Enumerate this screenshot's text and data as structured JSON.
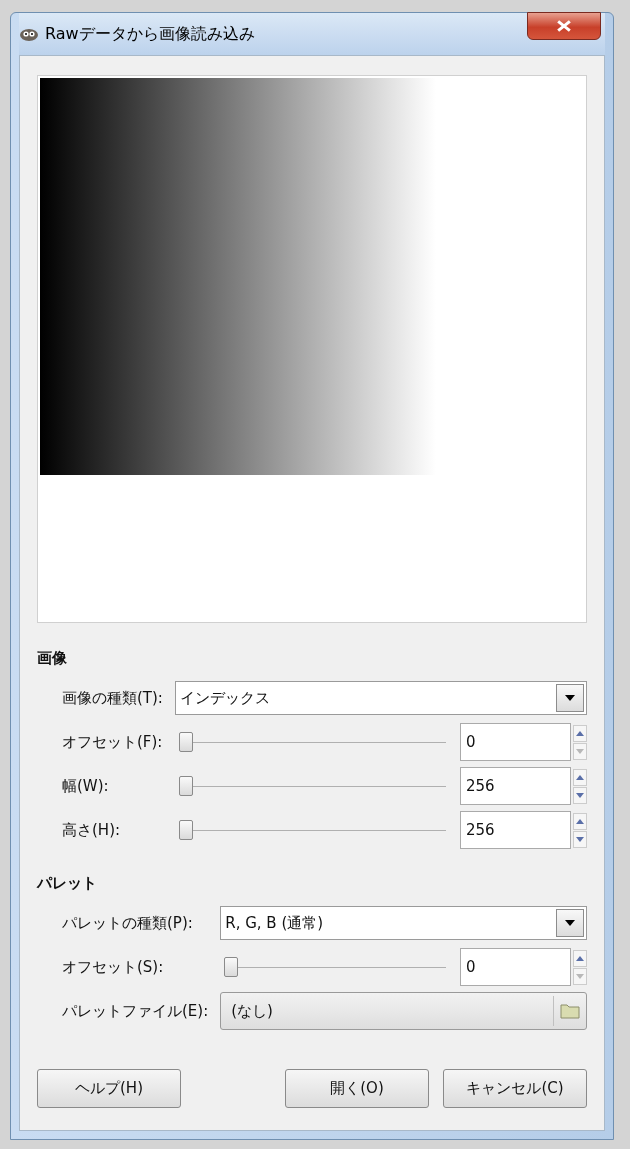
{
  "window": {
    "title": "Rawデータから画像読み込み"
  },
  "preview": {
    "kind": "gradient"
  },
  "sections": [
    {
      "title": "画像",
      "rows": [
        {
          "kind": "combo",
          "label": "画像の種類(T):",
          "value": "インデックス"
        },
        {
          "kind": "slider",
          "label": "オフセット(F):",
          "level": 0,
          "value": "0",
          "down_disabled": true
        },
        {
          "kind": "slider",
          "label": "幅(W):",
          "level": 0,
          "value": "256",
          "down_disabled": false
        },
        {
          "kind": "slider",
          "label": "高さ(H):",
          "level": 0,
          "value": "256",
          "down_disabled": false
        }
      ]
    },
    {
      "title": "パレット",
      "rows": [
        {
          "kind": "combo",
          "label": "パレットの種類(P):",
          "value": "R, G, B (通常)"
        },
        {
          "kind": "slider",
          "label": "オフセット(S):",
          "level": 0,
          "value": "0",
          "down_disabled": true
        },
        {
          "kind": "file",
          "label": "パレットファイル(E):",
          "value": "(なし)"
        }
      ]
    }
  ],
  "buttons": [
    "ヘルプ(H)",
    "開く(O)",
    "キャンセル(C)"
  ]
}
